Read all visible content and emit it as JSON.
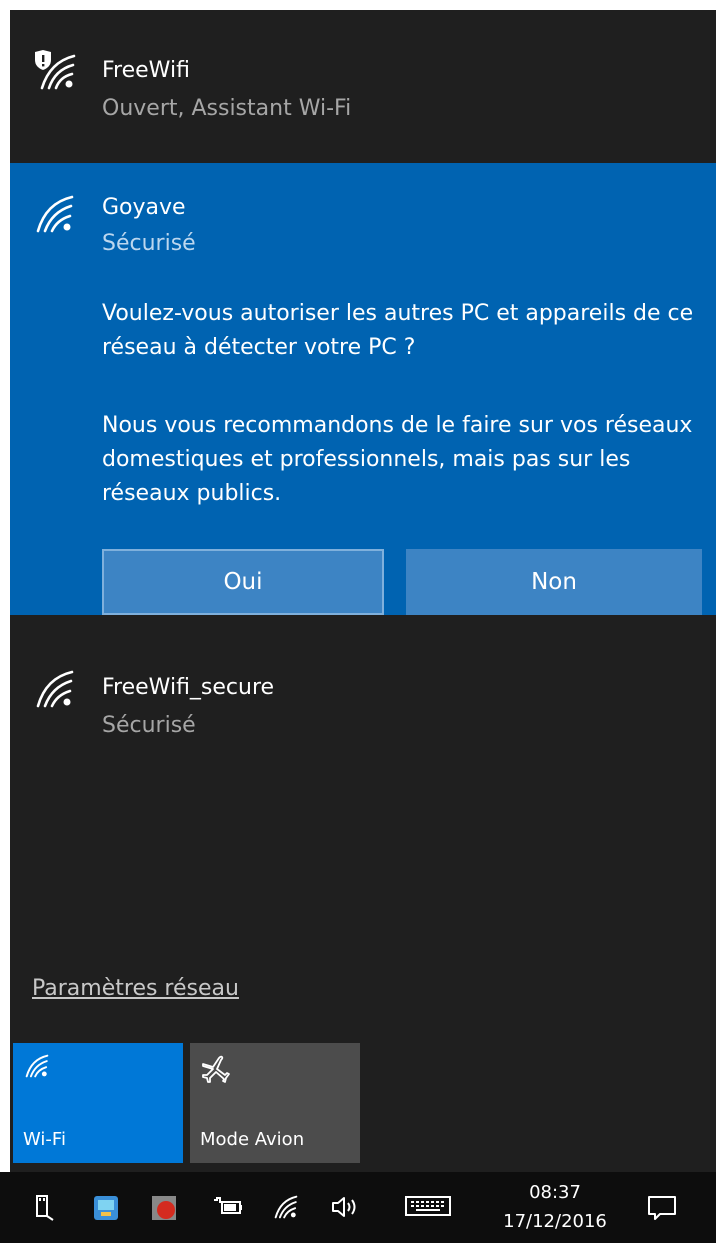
{
  "networks": [
    {
      "name": "FreeWifi",
      "status": "Ouvert, Assistant Wi-Fi",
      "icon": "wifi-shield-icon"
    },
    {
      "name": "Goyave",
      "status": "Sécurisé",
      "icon": "wifi-icon"
    },
    {
      "name": "FreeWifi_secure",
      "status": "Sécurisé",
      "icon": "wifi-icon"
    }
  ],
  "discovery_prompt": {
    "question": "Voulez-vous autoriser les autres PC et appareils de ce réseau à détecter votre PC ?",
    "recommendation": "Nous vous recommandons de le faire sur vos réseaux domestiques et professionnels, mais pas sur les réseaux publics.",
    "yes_label": "Oui",
    "no_label": "Non"
  },
  "settings_link": "Paramètres réseau",
  "quick_actions": [
    {
      "label": "Wi-Fi",
      "icon": "wifi-icon",
      "active": true
    },
    {
      "label": "Mode Avion",
      "icon": "airplane-icon",
      "active": false
    }
  ],
  "taskbar": {
    "time": "08:37",
    "date": "17/12/2016",
    "icons": [
      "usb-icon",
      "network-app-icon",
      "record-app-icon",
      "battery-icon",
      "wifi-icon",
      "volume-icon",
      "keyboard-icon",
      "action-center-icon"
    ]
  },
  "colors": {
    "flyout_bg": "#1f1f1f",
    "accent": "#0063b1",
    "tile_active": "#0078d7",
    "tile_inactive": "#4c4c4c",
    "taskbar_bg": "#0d0d0d"
  }
}
